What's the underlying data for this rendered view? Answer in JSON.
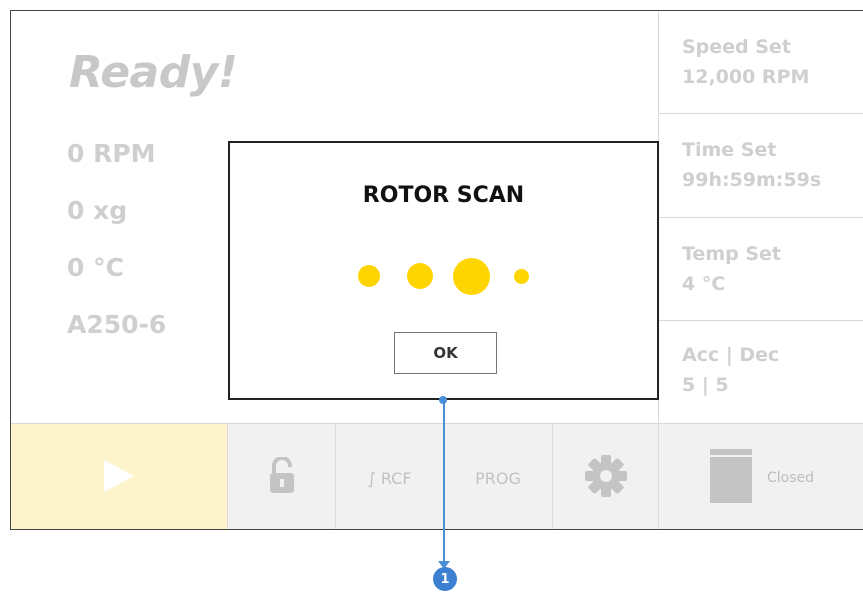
{
  "status": {
    "title": "Ready!",
    "speed": "0 RPM",
    "force": "0 xg",
    "temp": "0 °C",
    "rotor": "A250-6"
  },
  "settings": [
    {
      "label": "Speed Set",
      "value": "12,000 RPM"
    },
    {
      "label": "Time Set",
      "value": "99h:59m:59s"
    },
    {
      "label": "Temp Set",
      "value": "4 °C"
    },
    {
      "label": "Acc | Dec",
      "value": "5 | 5"
    }
  ],
  "toolbar": {
    "play_icon": "play-icon",
    "lock_icon": "unlock-icon",
    "rcf_label": "∫ RCF",
    "prog_label": "PROG",
    "settings_icon": "gear-icon",
    "lid_icon": "lid-icon",
    "lid_status": "Closed"
  },
  "modal": {
    "title": "ROTOR SCAN",
    "ok_label": "OK",
    "dot_color": "#ffd500"
  },
  "callout": {
    "number": "1"
  },
  "colors": {
    "accent": "#ffd500",
    "play_bg": "#fdf4cc",
    "callout": "#3d7fd1"
  }
}
